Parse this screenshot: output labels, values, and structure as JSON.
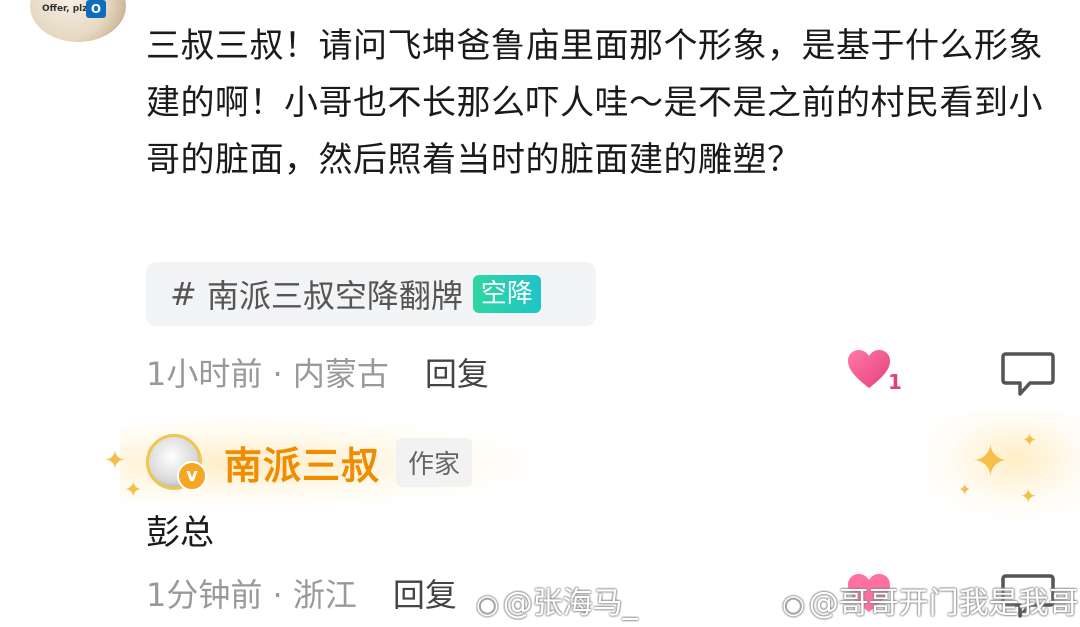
{
  "top_avatar": {
    "caption": "Offer, plz",
    "app_badge": "O"
  },
  "comment": {
    "text": "三叔三叔！请问飞坤爸鲁庙里面那个形象，是基于什么形象建的啊！小哥也不长那么吓人哇～是不是之前的村民看到小哥的脏面，然后照着当时的脏面建的雕塑？",
    "topic": {
      "hash": "#",
      "label": "南派三叔空降翻牌",
      "badge": "空降"
    },
    "meta": {
      "time_location": "1小时前 · 内蒙古",
      "reply_label": "回复"
    },
    "likes": "1"
  },
  "reply": {
    "author": {
      "name": "南派三叔",
      "tag": "作家",
      "verified_mark": "v"
    },
    "text": "彭总",
    "meta": {
      "time_location": "1分钟前 · 浙江",
      "reply_label": "回复"
    }
  },
  "watermarks": [
    {
      "text": "@张海马_"
    },
    {
      "text": "@哥哥开门我是我哥"
    }
  ],
  "colors": {
    "author_name": "#f08c00",
    "like": "#e6407a",
    "badge": "#2fd6a0"
  }
}
